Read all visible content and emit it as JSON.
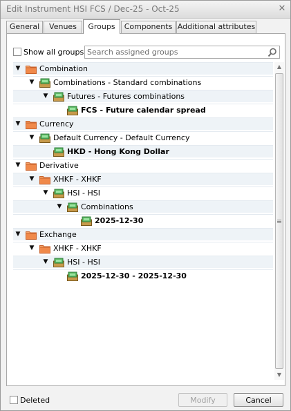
{
  "window": {
    "title": "Edit Instrument HSI FCS / Dec-25 - Oct-25",
    "close_glyph": "✕"
  },
  "tabs": [
    {
      "label": "General",
      "active": false
    },
    {
      "label": "Venues",
      "active": false
    },
    {
      "label": "Groups",
      "active": true
    },
    {
      "label": "Components",
      "active": false
    },
    {
      "label": "Additional attributes",
      "active": false
    }
  ],
  "groups_panel": {
    "show_all_label": "Show all groups",
    "show_all_checked": false,
    "search_placeholder": "Search assigned groups",
    "search_value": ""
  },
  "tree": [
    {
      "label": "Combination",
      "icon": "folder-icon",
      "expanded": true,
      "bold": false
    },
    {
      "label": "Combinations - Standard combinations",
      "icon": "group-icon",
      "expanded": true,
      "bold": false
    },
    {
      "label": "Futures - Futures combinations",
      "icon": "group-icon",
      "expanded": true,
      "bold": false
    },
    {
      "label": "FCS - Future calendar spread",
      "icon": "group-icon",
      "expanded": null,
      "bold": true
    },
    {
      "label": "Currency",
      "icon": "folder-icon",
      "expanded": true,
      "bold": false
    },
    {
      "label": "Default Currency - Default Currency",
      "icon": "group-icon",
      "expanded": true,
      "bold": false
    },
    {
      "label": "HKD - Hong Kong Dollar",
      "icon": "group-icon",
      "expanded": null,
      "bold": true
    },
    {
      "label": "Derivative",
      "icon": "folder-icon",
      "expanded": true,
      "bold": false
    },
    {
      "label": "XHKF - XHKF",
      "icon": "folder-icon",
      "expanded": true,
      "bold": false
    },
    {
      "label": "HSI - HSI",
      "icon": "group-icon",
      "expanded": true,
      "bold": false
    },
    {
      "label": "Combinations",
      "icon": "group-icon",
      "expanded": true,
      "bold": false
    },
    {
      "label": "2025-12-30",
      "icon": "group-icon",
      "expanded": null,
      "bold": true
    },
    {
      "label": "Exchange",
      "icon": "folder-icon",
      "expanded": true,
      "bold": false
    },
    {
      "label": "XHKF - XHKF",
      "icon": "folder-icon",
      "expanded": true,
      "bold": false
    },
    {
      "label": "HSI - HSI",
      "icon": "group-icon",
      "expanded": true,
      "bold": false
    },
    {
      "label": "2025-12-30 - 2025-12-30",
      "icon": "group-icon",
      "expanded": null,
      "bold": true
    }
  ],
  "scrollbar": {
    "up_glyph": "▲",
    "down_glyph": "▼"
  },
  "footer": {
    "deleted_label": "Deleted",
    "deleted_checked": false,
    "modify_label": "Modify",
    "modify_enabled": false,
    "cancel_label": "Cancel"
  },
  "colors": {
    "folder": "#f0894a",
    "group_green": "#3f9a4a",
    "row_alt": "#eef3f7"
  }
}
